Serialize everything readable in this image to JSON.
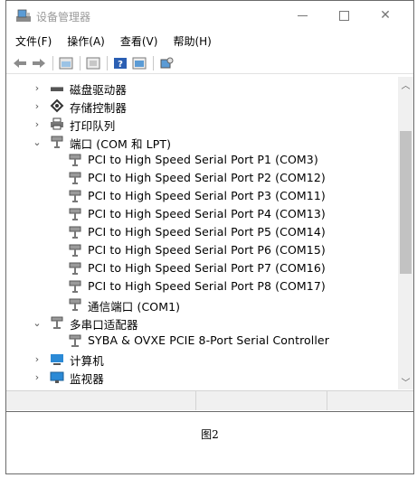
{
  "window": {
    "title": "设备管理器",
    "icon": "device-manager-icon"
  },
  "menu": [
    "文件(F)",
    "操作(A)",
    "查看(V)",
    "帮助(H)"
  ],
  "toolbar": {
    "buttons": [
      "back-icon",
      "forward-icon",
      "properties-icon",
      "refresh-icon",
      "help-icon",
      "view-icon",
      "scan-icon"
    ]
  },
  "tree": {
    "categories": [
      {
        "label": "磁盘驱动器",
        "expanded": false,
        "icon": "disk-icon"
      },
      {
        "label": "存储控制器",
        "expanded": false,
        "icon": "storage-icon"
      },
      {
        "label": "打印队列",
        "expanded": false,
        "icon": "printer-icon"
      },
      {
        "label": "端口 (COM 和 LPT)",
        "expanded": true,
        "icon": "port-icon"
      }
    ],
    "ports": [
      "PCI to High Speed Serial Port P1 (COM3)",
      "PCI to High Speed Serial Port P2 (COM12)",
      "PCI to High Speed Serial Port P3 (COM11)",
      "PCI to High Speed Serial Port P4 (COM13)",
      "PCI to High Speed Serial Port P5 (COM14)",
      "PCI to High Speed Serial Port P6 (COM15)",
      "PCI to High Speed Serial Port P7 (COM16)",
      "PCI to High Speed Serial Port P8 (COM17)",
      "通信端口 (COM1)"
    ],
    "multiport": {
      "label": "多串口适配器",
      "expanded": true,
      "child": "SYBA & OVXE PCIE 8-Port Serial Controller"
    },
    "tail": [
      {
        "label": "计算机",
        "expanded": false,
        "icon": "computer-icon"
      },
      {
        "label": "监视器",
        "expanded": false,
        "icon": "monitor-icon"
      }
    ]
  },
  "caption": "图2",
  "colors": {
    "arrow": "#555555",
    "scroll_thumb": "#c2c2c2",
    "statusbar": "#f0f0f0"
  }
}
